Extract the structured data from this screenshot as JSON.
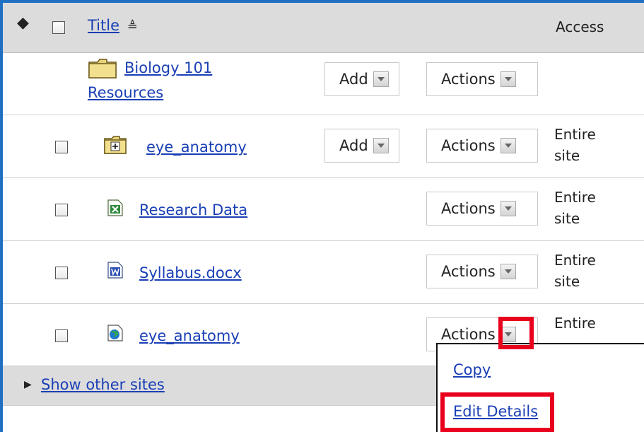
{
  "header": {
    "title_label": "Title",
    "sort_indicator": "≜",
    "access_label": "Access"
  },
  "rows": [
    {
      "name": "Biology 101 Resources",
      "name_line1": "Biology 101",
      "name_line2": "Resources",
      "icon": "folder-icon",
      "add_label": "Add",
      "actions_label": "Actions",
      "access": ""
    },
    {
      "name": "eye_anatomy",
      "icon": "folder-plus-icon",
      "add_label": "Add",
      "actions_label": "Actions",
      "access_line1": "Entire",
      "access_line2": "site"
    },
    {
      "name": "Research Data",
      "icon": "excel-file-icon",
      "actions_label": "Actions",
      "access_line1": "Entire",
      "access_line2": "site"
    },
    {
      "name": "Syllabus.docx",
      "icon": "word-file-icon",
      "actions_label": "Actions",
      "access_line1": "Entire",
      "access_line2": "site"
    },
    {
      "name": "eye_anatomy",
      "icon": "web-link-icon",
      "actions_label": "Actions",
      "access_line1": "Entire"
    }
  ],
  "footer": {
    "show_other_sites": "Show other sites"
  },
  "actions_menu": {
    "items": [
      "Copy",
      "Edit Details"
    ]
  },
  "colors": {
    "highlight": "#e8001c",
    "link": "#1a3fb5",
    "frame": "#1f6fc2",
    "header_bg": "#dcdcdc"
  }
}
